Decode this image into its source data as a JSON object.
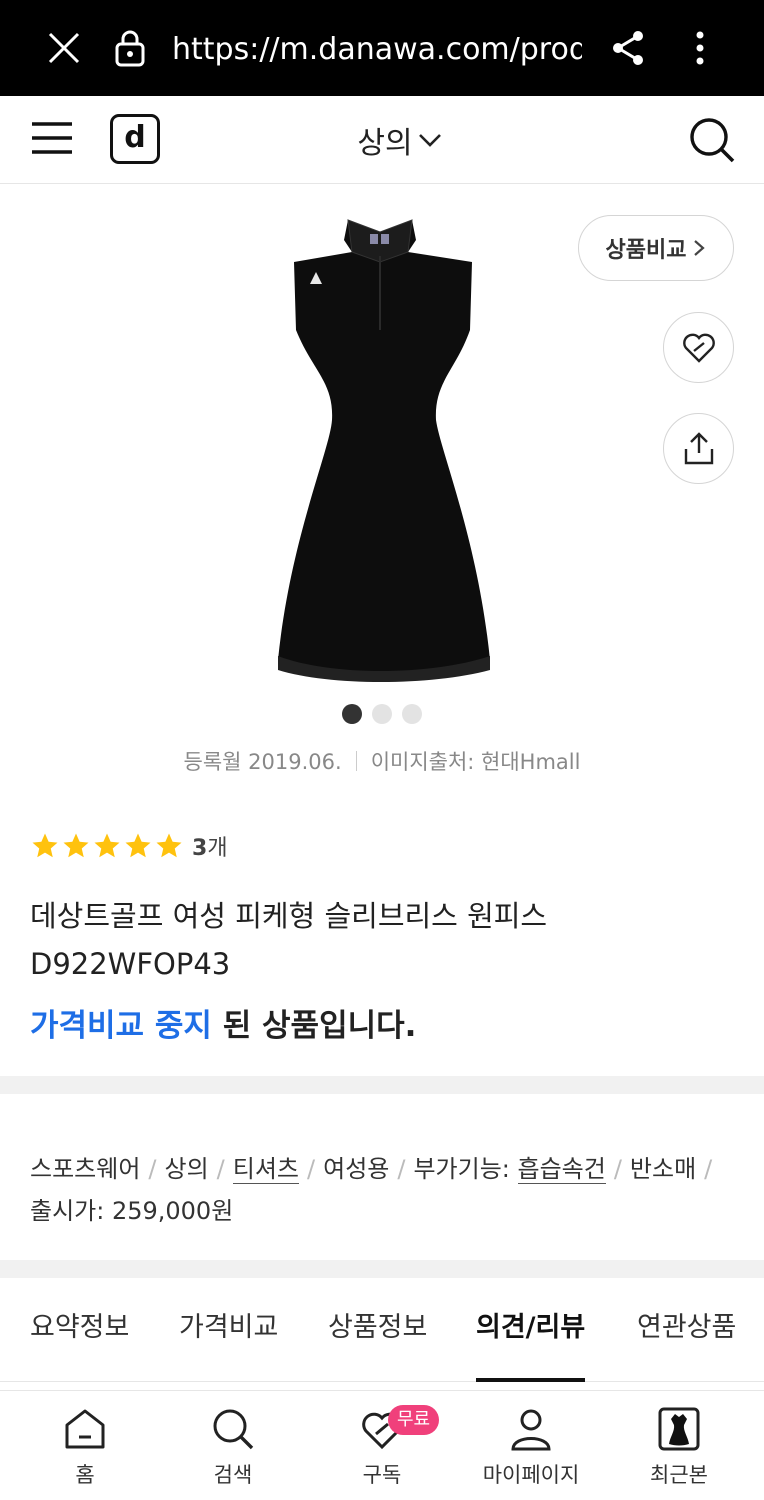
{
  "browser": {
    "url": "https://m.danawa.com/produ"
  },
  "header": {
    "logo": "d",
    "category": "상의"
  },
  "product": {
    "compare_label": "상품비교",
    "registered": "등록월 2019.06.",
    "image_source": "이미지출처: 현대Hmall",
    "rating_stars": 5,
    "review_count_number": "3",
    "review_count_unit": "개",
    "title": "데상트골프 여성 피케형 슬리브리스 원피스 D922WFOP43",
    "status_highlight": "가격비교 중지",
    "status_rest": " 된 상품입니다.",
    "carousel_total": 3,
    "carousel_active": 1
  },
  "spec": {
    "items": [
      "스포츠웨어",
      "상의",
      "티셔츠",
      "여성용",
      "부가기능: ",
      "흡습속건",
      "반소매",
      "출시가: 259,000원"
    ]
  },
  "tabs": [
    {
      "label": "요약정보"
    },
    {
      "label": "가격비교"
    },
    {
      "label": "상품정보"
    },
    {
      "label": "의견/리뷰"
    },
    {
      "label": "연관상품"
    }
  ],
  "bottom_nav": {
    "items": [
      {
        "label": "홈",
        "icon": "home-icon"
      },
      {
        "label": "검색",
        "icon": "search-icon"
      },
      {
        "label": "구독",
        "icon": "heart-icon"
      },
      {
        "label": "마이페이지",
        "icon": "person-icon"
      },
      {
        "label": "최근본",
        "icon": "recent-product-icon"
      }
    ],
    "badge": "무료"
  },
  "colors": {
    "accent": "#1e6ee6",
    "star": "#ffc20e",
    "badge": "#f0407b"
  }
}
